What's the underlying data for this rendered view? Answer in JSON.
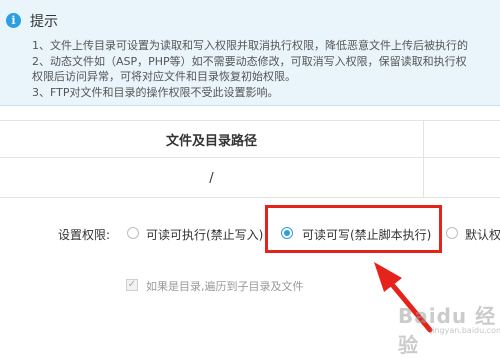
{
  "tip": {
    "icon": "info-icon",
    "title": "提示",
    "lines": [
      "1、文件上传目录可设置为读取和写入权限并取消执行权限，降低恶意文件上传后被执行的",
      "2、动态文件如（ASP，PHP等）如不需要动态修改，可取消写入权限，保留读取和执行权",
      "权限后访问异常，可将对应文件和目录恢复初始权限。",
      "3、FTP对文件和目录的操作权限不受此设置影响。"
    ]
  },
  "table": {
    "header": "文件及目录路径",
    "row_value": "/"
  },
  "permissions": {
    "label": "设置权限:",
    "options": [
      {
        "label": "可读可执行(禁止写入)",
        "checked": false
      },
      {
        "label": "可读可写(禁止脚本执行)",
        "checked": true
      },
      {
        "label": "默认权",
        "checked": false
      }
    ]
  },
  "recursive": {
    "label": "如果是目录,遍历到子目录及文件",
    "checked": true
  },
  "watermark": {
    "text": "Baidu 经验",
    "sub": "jingyan.baidu.com"
  },
  "colors": {
    "accent": "#2aa0e0",
    "highlight": "#e5231b",
    "tip_bg": "#eaf4fb"
  }
}
